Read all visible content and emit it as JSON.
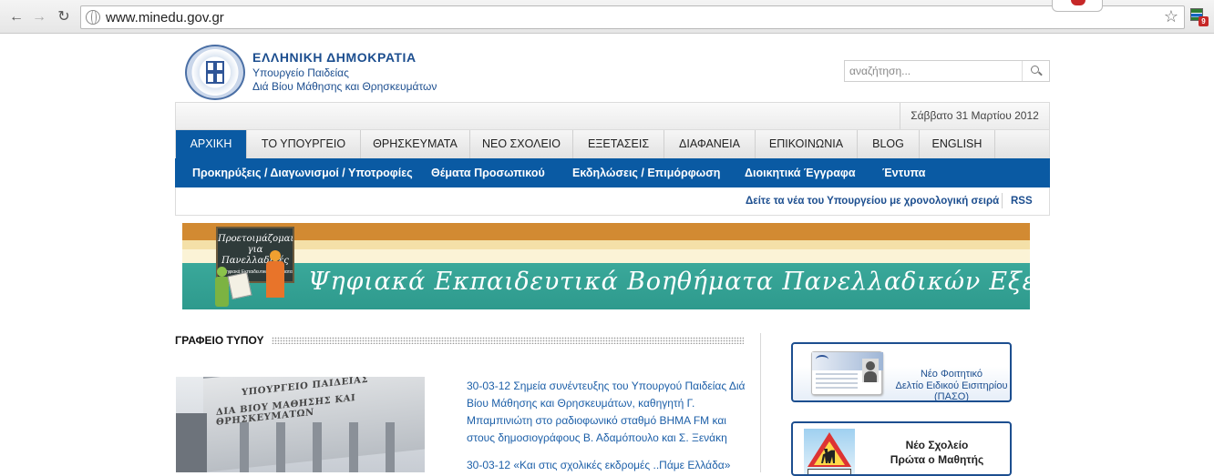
{
  "browser": {
    "url": "www.minedu.gov.gr",
    "extension_badge": "9"
  },
  "header": {
    "org_title": "ΕΛΛΗΝΙΚΗ ΔΗΜΟΚΡΑΤΙΑ",
    "org_subtitle_1": "Υπουργείο Παιδείας",
    "org_subtitle_2": "Διά Βίου Μάθησης και Θρησκευμάτων",
    "search_placeholder": "αναζήτηση..."
  },
  "date": "Σάββατο 31 Μαρτίου 2012",
  "main_nav": [
    {
      "label": "ΑΡΧΙΚΗ",
      "active": true
    },
    {
      "label": "ΤΟ ΥΠΟΥΡΓΕΙΟ"
    },
    {
      "label": "ΘΡΗΣΚΕΥΜΑΤΑ"
    },
    {
      "label": "ΝΕΟ ΣΧΟΛΕΙΟ"
    },
    {
      "label": "ΕΞΕΤΑΣΕΙΣ"
    },
    {
      "label": "ΔΙΑΦΑΝΕΙΑ"
    },
    {
      "label": "ΕΠΙΚΟΙΝΩΝΙΑ"
    },
    {
      "label": "BLOG"
    },
    {
      "label": "ENGLISH"
    }
  ],
  "sub_nav": [
    {
      "label": "Προκηρύξεις / Διαγωνισμοί / Υποτροφίες"
    },
    {
      "label": "Θέματα Προσωπικού"
    },
    {
      "label": "Εκδηλώσεις / Επιμόρφωση"
    },
    {
      "label": "Διοικητικά Έγγραφα"
    },
    {
      "label": "Έντυπα"
    }
  ],
  "news_bar": {
    "chronological_link": "Δείτε τα νέα του Υπουργείου με χρονολογική σειρά",
    "rss": "RSS"
  },
  "banner": {
    "board_line1": "Προετοιμάζομαι",
    "board_line2": "για",
    "board_line3": "Πανελλαδικές",
    "board_footer": "Ψηφιακά Εκπαιδευτικά Βοηθήματα",
    "title": "Ψηφιακά Εκπαιδευτικά Βοηθήματα Πανελλαδικών Εξετάσεων"
  },
  "press": {
    "section_title": "ΓΡΑΦΕΙΟ ΤΥΠΟΥ",
    "photo_sign_1": "ΥΠΟΥΡΓΕΙΟ ΠΑΙΔΕΙΑΣ",
    "photo_sign_2": "ΔΙΑ ΒΙΟΥ ΜΑΘΗΣΗΣ ΚΑΙ ΘΡΗΣΚΕΥΜΑΤΩΝ",
    "items": [
      {
        "text": "30-03-12 Σημεία συνέντευξης του Υπουργού Παιδείας Διά Βίου Μάθησης και Θρησκευμάτων, καθηγητή Γ. Μπαμπινιώτη στο ραδιοφωνικό σταθμό ΒΗΜΑ FM και στους δημοσιογράφους Β. Αδαμόπουλο και Σ. Ξενάκη"
      },
      {
        "text": "30-03-12 «Και στις σχολικές εκδρομές ..Πάμε Ελλάδα»"
      }
    ]
  },
  "sidebar": {
    "paso": {
      "line1": "Νέο Φοιτητικό",
      "line2": "Δελτίο Ειδικού Εισιτηρίου",
      "line3": "(ΠΑΣΟ)"
    },
    "school": {
      "line1": "Νέο Σχολείο",
      "line2": "Πρώτα ο Μαθητής"
    }
  }
}
